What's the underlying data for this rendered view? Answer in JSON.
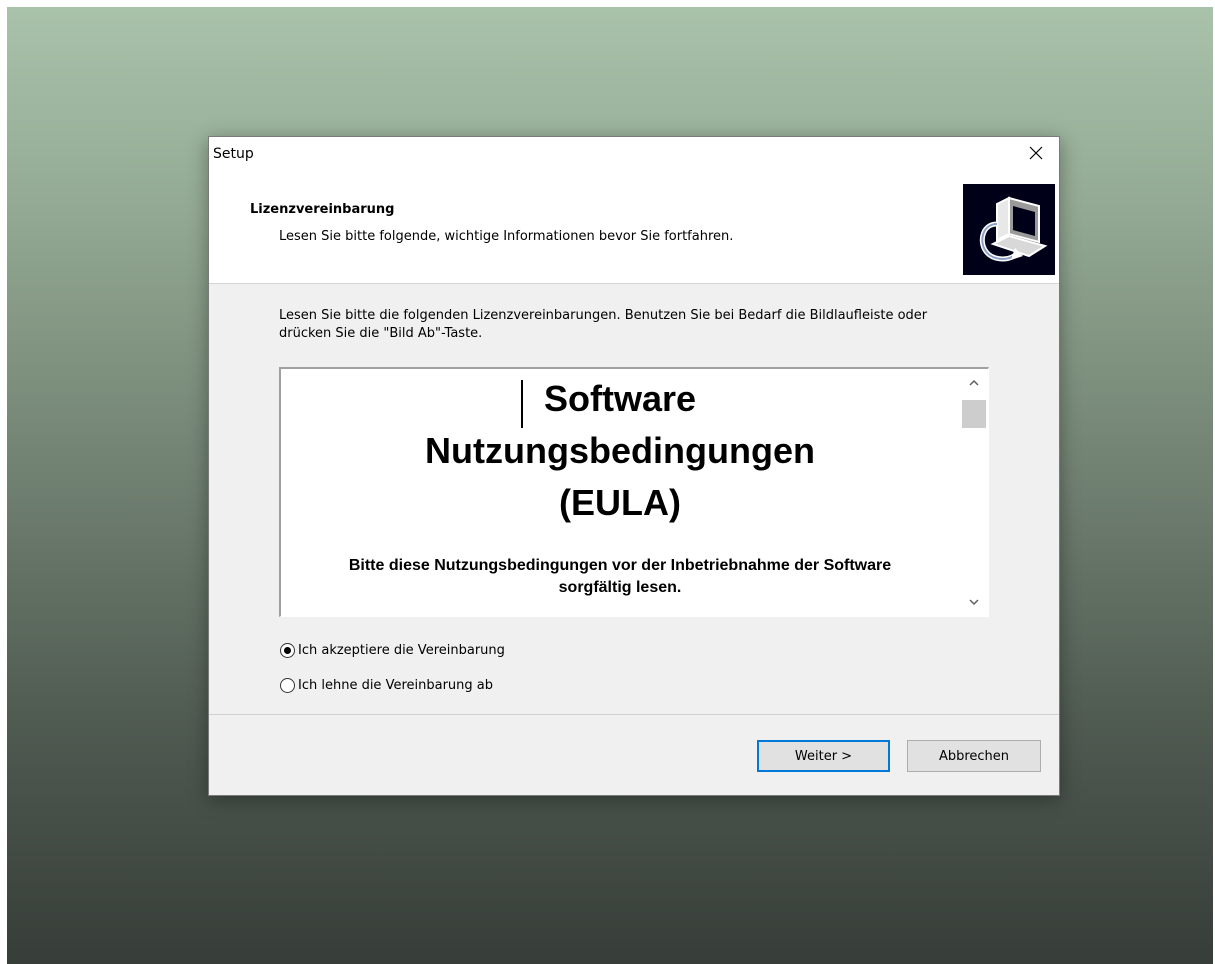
{
  "window": {
    "title": "Setup"
  },
  "header": {
    "title": "Lizenzvereinbarung",
    "subtitle": "Lesen Sie bitte folgende, wichtige Informationen bevor Sie fortfahren."
  },
  "instructions": "Lesen Sie bitte die folgenden Lizenzvereinbarungen. Benutzen Sie bei Bedarf die Bildlaufleiste oder drücken Sie die \"Bild Ab\"-Taste.",
  "eula": {
    "heading_line1": "Software",
    "heading_line2": "Nutzungsbedingungen",
    "heading_line3": "(EULA)",
    "paragraph": "Bitte diese Nutzungsbedingungen vor der Inbetriebnahme der Software sorgfältig lesen."
  },
  "options": {
    "accept_label": "Ich akzeptiere die Vereinbarung",
    "decline_label": "Ich lehne die Vereinbarung ab",
    "selected": "accept"
  },
  "buttons": {
    "next_label": "Weiter >",
    "cancel_label": "Abbrechen"
  },
  "icons": {
    "close": "close-icon",
    "setup": "setup-computer-icon",
    "scroll_up": "chevron-up-icon",
    "scroll_down": "chevron-down-icon"
  },
  "colors": {
    "accent": "#0078d7",
    "window_bg": "#f0f0f0"
  }
}
